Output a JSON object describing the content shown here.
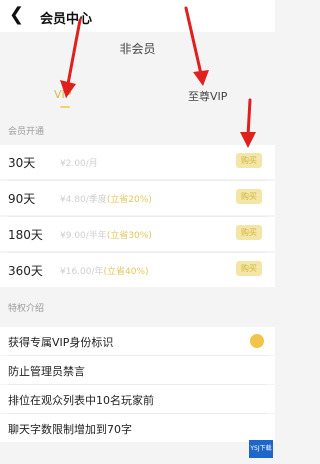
{
  "header": {
    "back_icon": "back-arrow-icon",
    "title": "会员中心"
  },
  "status": {
    "current": "非会员"
  },
  "tabs": [
    {
      "label": "VIP",
      "active": true
    },
    {
      "label": "至尊VIP",
      "active": false
    }
  ],
  "sections": {
    "plans_title": "会员开通",
    "features_title": "特权介绍"
  },
  "plans": [
    {
      "days": "30天",
      "price": "¥2.00/月",
      "save": "",
      "button": "购买"
    },
    {
      "days": "90天",
      "price": "¥4.80/季度",
      "save": "(立省20%)",
      "button": "购买"
    },
    {
      "days": "180天",
      "price": "¥9.00/半年",
      "save": "(立省30%)",
      "button": "购买"
    },
    {
      "days": "360天",
      "price": "¥16.00/年",
      "save": "(立省40%)",
      "button": "购买"
    }
  ],
  "features": [
    {
      "label": "获得专属VIP身份标识",
      "badge": true
    },
    {
      "label": "防止管理员禁言",
      "badge": false
    },
    {
      "label": "排位在观众列表中10名玩家前",
      "badge": false
    },
    {
      "label": "聊天字数限制增加到70字",
      "badge": false
    }
  ],
  "colors": {
    "accent": "#d9b84a",
    "button_bg": "#f3e6a8",
    "arrow": "#e0201c"
  },
  "watermark": "YSJ下载"
}
